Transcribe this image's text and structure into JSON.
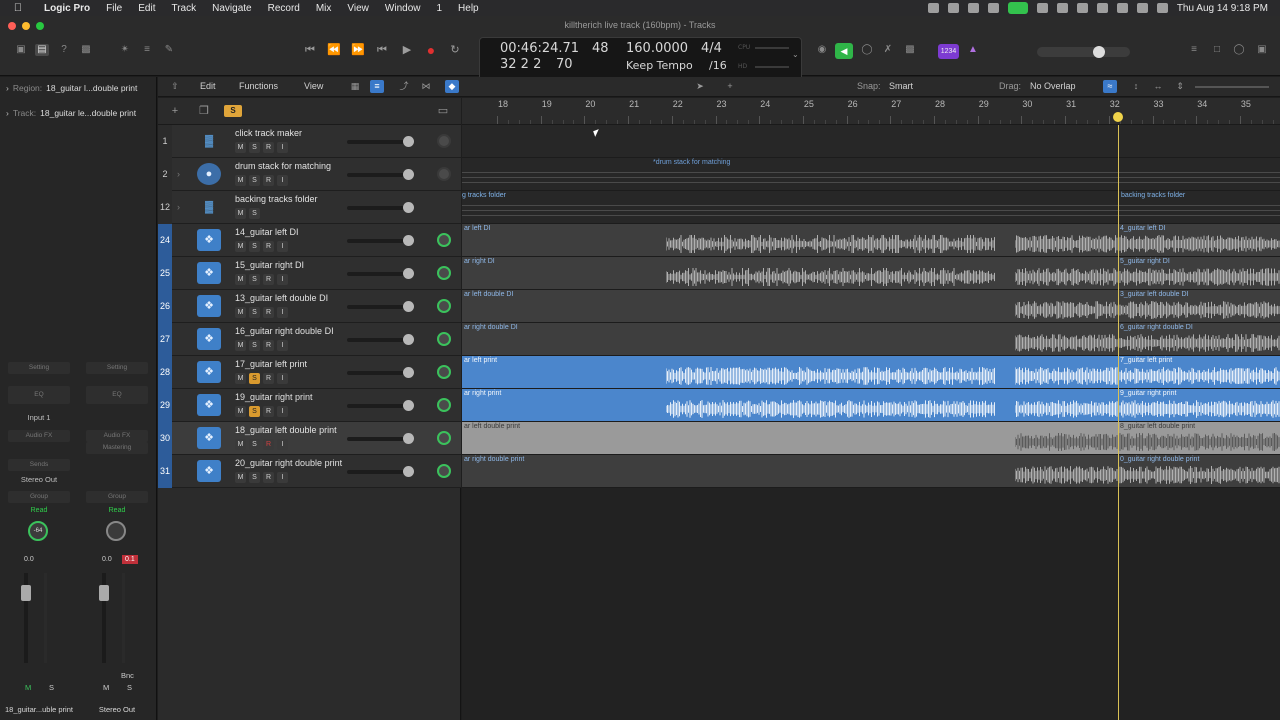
{
  "menubar": {
    "app": "Logic Pro",
    "items": [
      "File",
      "Edit",
      "Track",
      "Navigate",
      "Record",
      "Mix",
      "View",
      "Window",
      "1",
      "Help"
    ],
    "clock": "Thu Aug 14  9:18 PM"
  },
  "window": {
    "title": "killtherich live track (160bpm) - Tracks"
  },
  "lcd": {
    "time": "00:46:24.71",
    "bars": "32  2  2",
    "ticks": "70",
    "beat_sub": "48",
    "tempo": "160.0000",
    "tempo_mode": "Keep Tempo",
    "signature": "4/4",
    "division": "/16",
    "label_cpu": "CPU",
    "label_hd": "HD"
  },
  "control_bar": {
    "midi_badge": "1234"
  },
  "inspector": {
    "region_label": "Region:",
    "region_name": "18_guitar l...double print",
    "track_label": "Track:",
    "track_name": "18_guitar le...double print",
    "strips": [
      {
        "setting": "Setting",
        "eq": "EQ",
        "input": "Input 1",
        "fx": "Audio FX",
        "sends": "Sends",
        "output": "Stereo Out",
        "group": "Group",
        "automation": "Read",
        "pan": "-64",
        "vol": "0.0",
        "peak": "",
        "mute": "M",
        "solo": "S",
        "name": "18_guitar...uble print"
      },
      {
        "setting": "Setting",
        "eq": "EQ",
        "input": "",
        "fx": "Audio FX",
        "fx2": "Mastering",
        "sends": "",
        "output": "",
        "group": "Group",
        "automation": "Read",
        "pan": "",
        "vol": "0.0",
        "peak": "0.1",
        "bnc": "Bnc",
        "mute": "M",
        "solo": "S",
        "name": "Stereo Out"
      }
    ]
  },
  "tracks_toolbar": {
    "edit": "Edit",
    "functions": "Functions",
    "view": "View",
    "snap_label": "Snap:",
    "snap_value": "Smart",
    "drag_label": "Drag:",
    "drag_value": "No Overlap"
  },
  "track_header": {
    "solo_badge": "S"
  },
  "ruler": {
    "bars": [
      "18",
      "19",
      "20",
      "21",
      "22",
      "23",
      "24",
      "25",
      "26",
      "27",
      "28",
      "29",
      "30",
      "31",
      "32",
      "33",
      "34",
      "35"
    ]
  },
  "tracks": [
    {
      "number": "1",
      "name": "click track maker",
      "buttons": [
        "M",
        "S",
        "R",
        "I"
      ],
      "solo_on": false
    },
    {
      "number": "2",
      "name": "drum stack for matching",
      "buttons": [
        "M",
        "S",
        "R",
        "I"
      ],
      "solo_on": false
    },
    {
      "number": "12",
      "name": "backing tracks folder",
      "buttons": [
        "M",
        "S"
      ],
      "solo_on": false
    },
    {
      "number": "24",
      "name": "14_guitar left DI",
      "buttons": [
        "M",
        "S",
        "R",
        "I"
      ],
      "solo_on": false
    },
    {
      "number": "25",
      "name": "15_guitar right DI",
      "buttons": [
        "M",
        "S",
        "R",
        "I"
      ],
      "solo_on": false
    },
    {
      "number": "26",
      "name": "13_guitar left double DI",
      "buttons": [
        "M",
        "S",
        "R",
        "I"
      ],
      "solo_on": false
    },
    {
      "number": "27",
      "name": "16_guitar right double DI",
      "buttons": [
        "M",
        "S",
        "R",
        "I"
      ],
      "solo_on": false
    },
    {
      "number": "28",
      "name": "17_guitar left print",
      "buttons": [
        "M",
        "S",
        "R",
        "I"
      ],
      "solo_on": true
    },
    {
      "number": "29",
      "name": "19_guitar right print",
      "buttons": [
        "M",
        "S",
        "R",
        "I"
      ],
      "solo_on": true
    },
    {
      "number": "30",
      "name": "18_guitar left double print",
      "buttons": [
        "M",
        "S",
        "R",
        "I"
      ],
      "solo_on": false
    },
    {
      "number": "31",
      "name": "20_guitar right double print",
      "buttons": [
        "M",
        "S",
        "R",
        "I"
      ],
      "solo_on": false
    }
  ],
  "regions": {
    "drum_stack": "*drum stack for matching",
    "backing_left": "g tracks folder",
    "backing_right": "backing tracks folder",
    "lane_24_left": "ar left DI",
    "lane_24_right": "4_guitar left DI",
    "lane_25_left": "ar right DI",
    "lane_25_right": "5_guitar right DI",
    "lane_26_left": "ar left double DI",
    "lane_26_right": "3_guitar left double DI",
    "lane_27_left": "ar right double DI",
    "lane_27_right": "6_guitar right double DI",
    "lane_28_left": "ar left print",
    "lane_28_right": "7_guitar left print",
    "lane_29_left": "ar right print",
    "lane_29_right": "9_guitar right print",
    "lane_30_left": "ar left double print",
    "lane_30_right": "8_guitar left double print",
    "lane_31_left": "ar right double print",
    "lane_31_right": "0_guitar right double print"
  },
  "colors": {
    "track_blue": "#2d5c9a",
    "region_blue": "#4b86cc",
    "solo_yellow": "#e0a53a",
    "record_red": "#e03030",
    "playhead": "#d9c155",
    "automation_green": "#2fcf4b"
  }
}
